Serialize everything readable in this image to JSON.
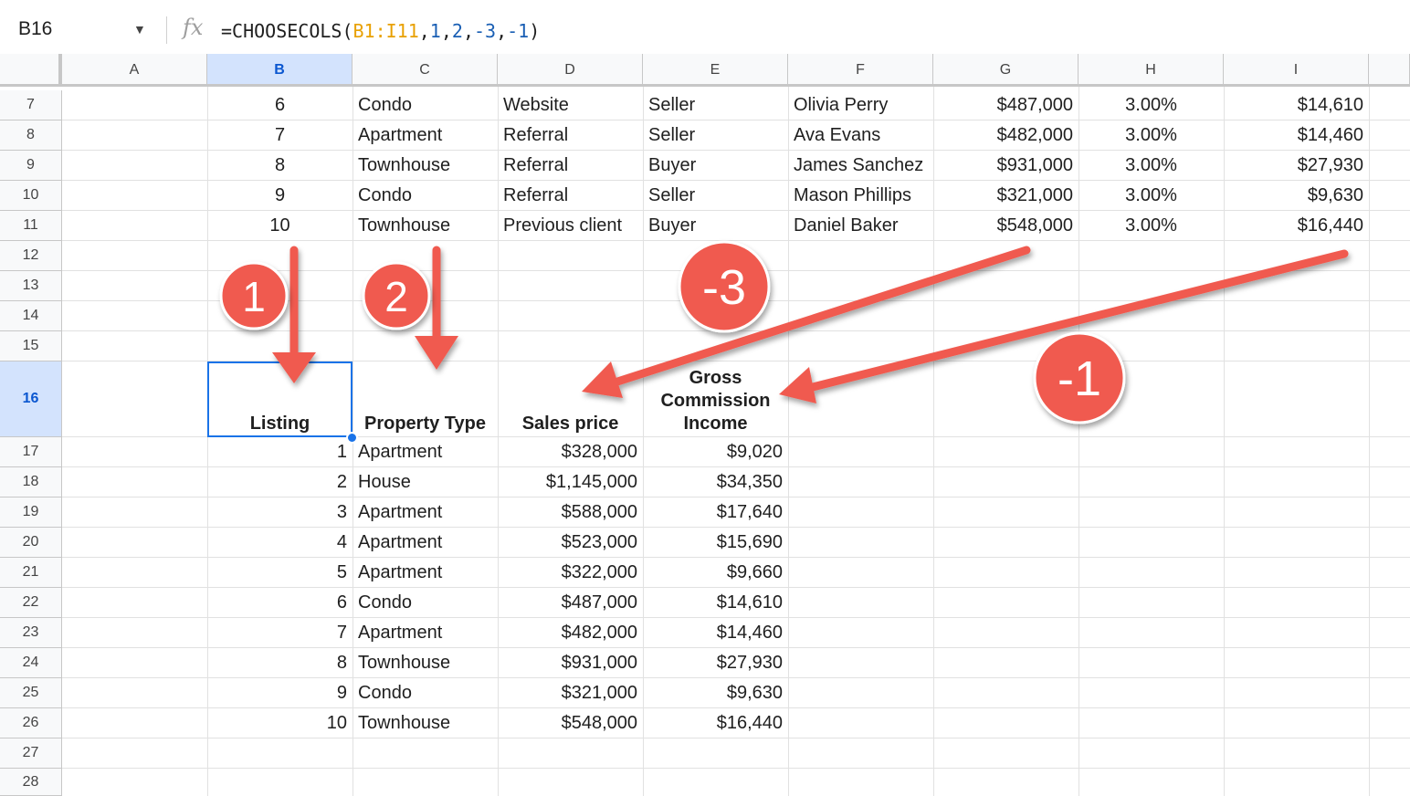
{
  "formula_bar": {
    "name_box": "B16",
    "fx_label": "fx",
    "formula_prefix": "=CHOOSECOLS(",
    "formula_range": "B1:I11",
    "formula_sep1": ",",
    "formula_arg1": "1",
    "formula_sep2": ",",
    "formula_arg2": "2",
    "formula_sep3": ",",
    "formula_arg3": "-3",
    "formula_sep4": ",",
    "formula_arg4": "-1",
    "formula_suffix": ")"
  },
  "columns": [
    "A",
    "B",
    "C",
    "D",
    "E",
    "F",
    "G",
    "H",
    "I"
  ],
  "rows": [
    "7",
    "8",
    "9",
    "10",
    "11",
    "12",
    "13",
    "14",
    "15",
    "16",
    "17",
    "18",
    "19",
    "20",
    "21",
    "22",
    "23",
    "24",
    "25",
    "26",
    "27",
    "28"
  ],
  "source_rows": [
    [
      "6",
      "Condo",
      "Website",
      "Seller",
      "Olivia Perry",
      "$487,000",
      "3.00%",
      "$14,610"
    ],
    [
      "7",
      "Apartment",
      "Referral",
      "Seller",
      "Ava Evans",
      "$482,000",
      "3.00%",
      "$14,460"
    ],
    [
      "8",
      "Townhouse",
      "Referral",
      "Buyer",
      "James Sanchez",
      "$931,000",
      "3.00%",
      "$27,930"
    ],
    [
      "9",
      "Condo",
      "Referral",
      "Seller",
      "Mason Phillips",
      "$321,000",
      "3.00%",
      "$9,630"
    ],
    [
      "10",
      "Townhouse",
      "Previous client",
      "Buyer",
      "Daniel Baker",
      "$548,000",
      "3.00%",
      "$16,440"
    ]
  ],
  "result_headers": {
    "b": "Listing",
    "c": "Property Type",
    "d": "Sales price",
    "e_line1": "Gross",
    "e_line2": "Commission",
    "e_line3": "Income"
  },
  "result_rows": [
    [
      "1",
      "Apartment",
      "$328,000",
      "$9,020"
    ],
    [
      "2",
      "House",
      "$1,145,000",
      "$34,350"
    ],
    [
      "3",
      "Apartment",
      "$588,000",
      "$17,640"
    ],
    [
      "4",
      "Apartment",
      "$523,000",
      "$15,690"
    ],
    [
      "5",
      "Apartment",
      "$322,000",
      "$9,660"
    ],
    [
      "6",
      "Condo",
      "$487,000",
      "$14,610"
    ],
    [
      "7",
      "Apartment",
      "$482,000",
      "$14,460"
    ],
    [
      "8",
      "Townhouse",
      "$931,000",
      "$27,930"
    ],
    [
      "9",
      "Condo",
      "$321,000",
      "$9,630"
    ],
    [
      "10",
      "Townhouse",
      "$548,000",
      "$16,440"
    ]
  ],
  "annotations": {
    "badge_1": "1",
    "badge_2": "2",
    "badge_neg3": "-3",
    "badge_neg1": "-1"
  },
  "colors": {
    "arrow": "#f05a4f",
    "selection": "#1a73e8",
    "header_selected_bg": "#d3e3fd"
  }
}
